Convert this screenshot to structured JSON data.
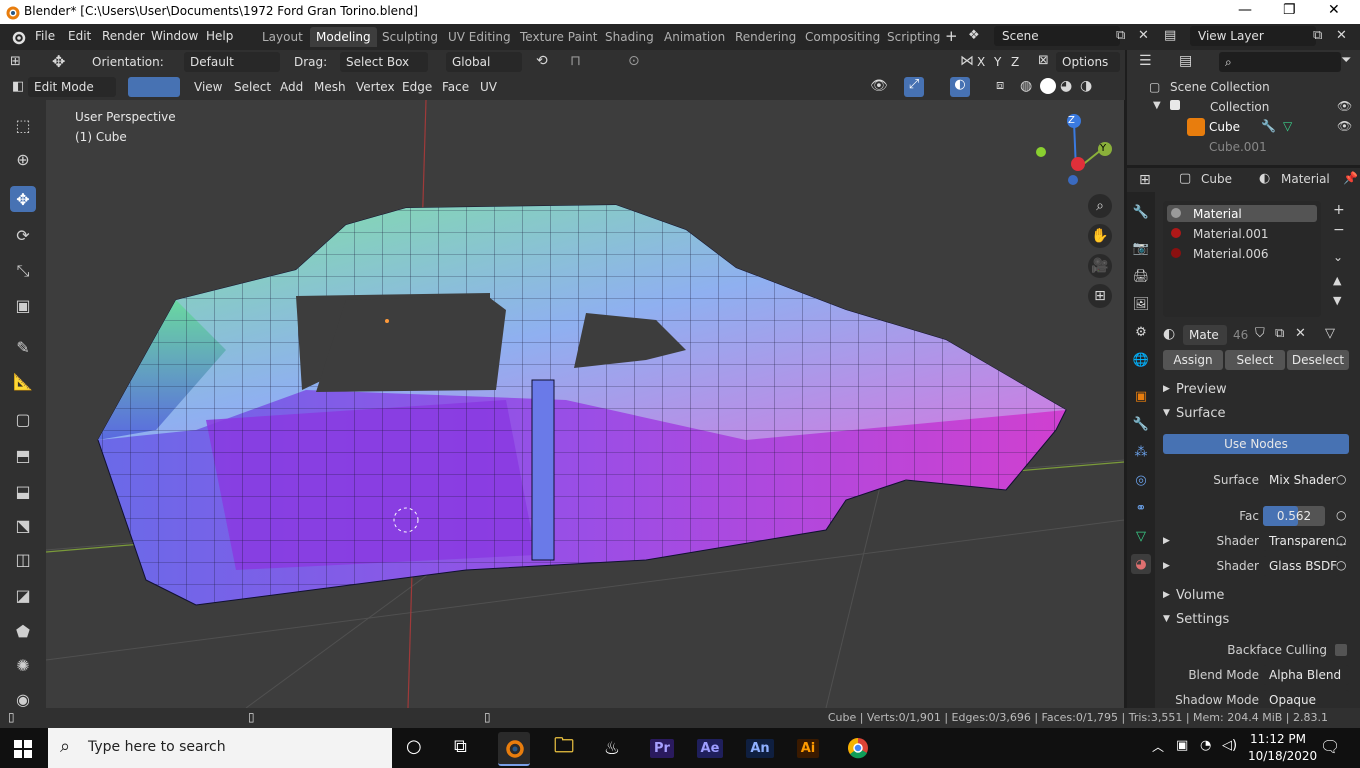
{
  "window": {
    "title": "Blender* [C:\\Users\\User\\Documents\\1972 Ford Gran Torino.blend]",
    "min": "—",
    "max": "❐",
    "close": "✕"
  },
  "menus": [
    "File",
    "Edit",
    "Render",
    "Window",
    "Help"
  ],
  "workspaces": [
    "Layout",
    "Modeling",
    "Sculpting",
    "UV Editing",
    "Texture Paint",
    "Shading",
    "Animation",
    "Rendering",
    "Compositing",
    "Scripting"
  ],
  "active_workspace": "Modeling",
  "scene": "Scene",
  "view_layer": "View Layer",
  "tool_header": {
    "orientation_label": "Orientation:",
    "orientation_value": "Default",
    "drag_label": "Drag:",
    "drag_value": "Select Box",
    "transform_value": "Global",
    "options": "Options"
  },
  "axes_lock": [
    "X",
    "Y",
    "Z"
  ],
  "edit_header": {
    "mode": "Edit Mode",
    "items": [
      "View",
      "Select",
      "Add",
      "Mesh",
      "Vertex",
      "Edge",
      "Face",
      "UV"
    ]
  },
  "viewport": {
    "perspective": "User Perspective",
    "object": "(1) Cube",
    "gizmo": {
      "z": "Z",
      "y": "Y"
    }
  },
  "outliner": {
    "root": "Scene Collection",
    "collection": "Collection",
    "items": [
      "Cube",
      "Cube.001"
    ]
  },
  "properties": {
    "object": "Cube",
    "tab": "Material",
    "slots": [
      {
        "name": "Material",
        "color": "#9a9a9a"
      },
      {
        "name": "Material.001",
        "color": "#b01818"
      },
      {
        "name": "Material.006",
        "color": "#8a1010"
      }
    ],
    "material_name": "Mate",
    "users": "46",
    "assign": "Assign",
    "select": "Select",
    "deselect": "Deselect",
    "preview": "Preview",
    "surface_header": "Surface",
    "use_nodes": "Use Nodes",
    "surface_label": "Surface",
    "surface_value": "Mix Shader",
    "fac_label": "Fac",
    "fac_value": "0.562",
    "fac_fraction": 0.562,
    "shader1_label": "Shader",
    "shader1_value": "Transparen...",
    "shader2_label": "Shader",
    "shader2_value": "Glass BSDF",
    "volume": "Volume",
    "settings": "Settings",
    "backface": "Backface Culling",
    "blend_label": "Blend Mode",
    "blend_value": "Alpha Blend",
    "shadow_label": "Shadow Mode",
    "shadow_value": "Opaque"
  },
  "status": "Cube | Verts:0/1,901 | Edges:0/3,696 | Faces:0/1,795 | Tris:3,551 | Mem: 204.4 MiB | 2.83.1",
  "taskbar": {
    "search_placeholder": "Type here to search",
    "apps": [
      {
        "label": "Pr",
        "bg": "#2a1a5e",
        "fg": "#a8a0ff"
      },
      {
        "label": "Ae",
        "bg": "#1f1f5c",
        "fg": "#9d9dff"
      },
      {
        "label": "An",
        "bg": "#0f1f40",
        "fg": "#8fb0ff"
      },
      {
        "label": "Ai",
        "bg": "#3a1a00",
        "fg": "#ff9a00"
      }
    ],
    "time": "11:12 PM",
    "date": "10/18/2020"
  },
  "colors": {
    "accent": "#4772b3",
    "header": "#303030",
    "viewport": "#3d3d3d"
  }
}
